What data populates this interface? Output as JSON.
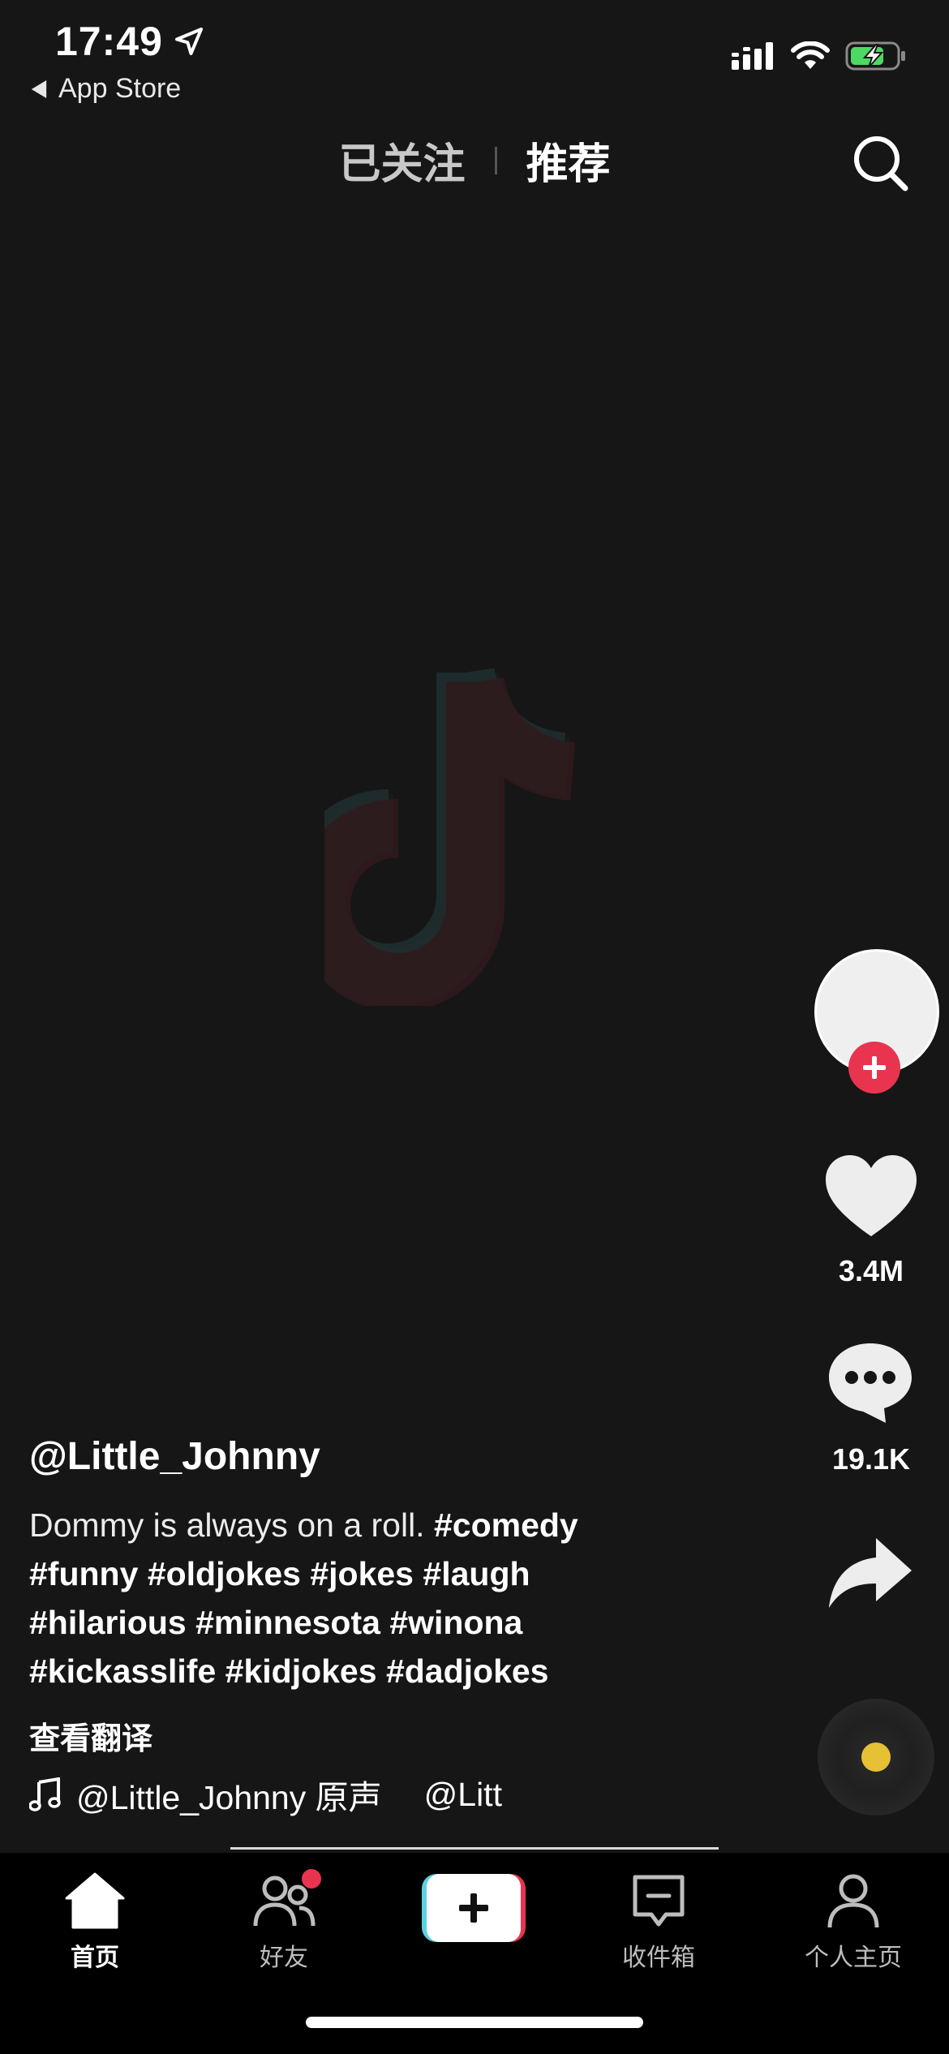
{
  "status_bar": {
    "time": "17:49",
    "back_app": "App Store",
    "icons": [
      "location-arrow-icon",
      "cellular-signal-icon",
      "wifi-icon",
      "battery-charging-icon"
    ]
  },
  "top_tabs": {
    "following": "已关注",
    "for_you": "推荐",
    "active": "推荐"
  },
  "video": {
    "username": "@Little_Johnny",
    "caption_text": "Dommy is always on a roll. ",
    "hashtags": [
      "#comedy",
      "#funny",
      "#oldjokes",
      "#jokes",
      "#laugh",
      "#hilarious",
      "#minnesota",
      "#winona",
      "#kickasslife",
      "#kidjokes",
      "#dadjokes"
    ],
    "translate_label": "查看翻译",
    "music_label": "@Little_Johnny 原声",
    "music_scroll_text": "@Litt"
  },
  "right_rail": {
    "likes": "3.4M",
    "comments": "19.1K"
  },
  "bottom_nav": {
    "home": "首页",
    "friends": "好友",
    "inbox": "收件箱",
    "profile": "个人主页"
  },
  "colors": {
    "background": "#161616",
    "accent_red": "#e8344e",
    "accent_cyan": "#5bd2e0",
    "disc_center": "#e6c136"
  }
}
